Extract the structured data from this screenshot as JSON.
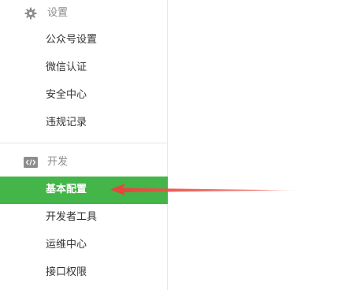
{
  "sidebar": {
    "settings": {
      "title": "设置",
      "icon": "gear-icon",
      "items": [
        {
          "label": "公众号设置"
        },
        {
          "label": "微信认证"
        },
        {
          "label": "安全中心"
        },
        {
          "label": "违规记录"
        }
      ]
    },
    "develop": {
      "title": "开发",
      "icon": "code-icon",
      "items": [
        {
          "label": "基本配置",
          "active": true
        },
        {
          "label": "开发者工具"
        },
        {
          "label": "运维中心"
        },
        {
          "label": "接口权限"
        }
      ]
    }
  },
  "annotation": {
    "type": "red-arrow",
    "points_to": "基本配置",
    "color": "#e8453c"
  },
  "colors": {
    "active_bg": "#44b549",
    "header_text": "#8d8d8d",
    "item_text": "#333333",
    "border": "#e7e7eb"
  }
}
